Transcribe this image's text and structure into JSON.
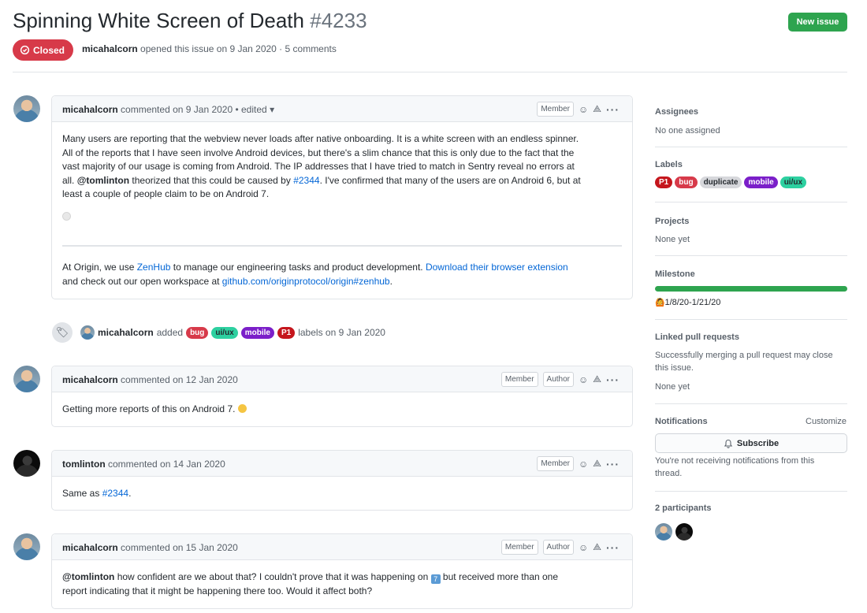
{
  "issue": {
    "title": "Spinning White Screen of Death",
    "number": "#4233",
    "new_issue_label": "New issue",
    "state": "Closed",
    "author": "micahalcorn",
    "meta": "opened this issue on 9 Jan 2020 · 5 comments"
  },
  "comments": [
    {
      "author": "micahalcorn",
      "meta": "commented on 9 Jan 2020 • edited",
      "badges": [
        "Member"
      ],
      "body_lines": [
        "Many users are reporting that the webview never loads after native onboarding. It is a white screen with an endless spinner.",
        "All of the reports that I have seen involve Android devices, but there's a slim chance that this is only due to the fact that the",
        "vast majority of our usage is coming from Android. The IP addresses that I have tried to match in Sentry reveal no errors at"
      ],
      "line4_pre": "all. ",
      "mention": "@tomlinton",
      "line4_mid": " theorized that this could be caused by ",
      "issue_ref": "#2344",
      "line4_post": ". I've confirmed that many of the users are on Android 6, but at",
      "line5": "least a couple of people claim to be on Android 7.",
      "footer_pre": "At Origin, we use ",
      "footer_link1": "ZenHub",
      "footer_mid": " to manage our engineering tasks and product development. ",
      "footer_link2": "Download their browser extension",
      "footer_line2_pre": "and check out our open workspace at ",
      "footer_link3": "github.com/originprotocol/origin#zenhub",
      "footer_end": "."
    },
    {
      "author": "micahalcorn",
      "meta": "commented on 12 Jan 2020",
      "badges": [
        "Member",
        "Author"
      ],
      "body": "Getting more reports of this on Android 7."
    },
    {
      "author": "tomlinton",
      "meta": "commented on 14 Jan 2020",
      "badges": [
        "Member"
      ],
      "body_pre": "Same as ",
      "issue_ref": "#2344",
      "body_post": "."
    },
    {
      "author": "micahalcorn",
      "meta": "commented on 15 Jan 2020",
      "badges": [
        "Member",
        "Author"
      ],
      "mention": "@tomlinton",
      "line1": " how confident are we about that? I couldn't prove that it was happening on ",
      "line1_post": " but received more than one",
      "line2": "report indicating that it might be happening there too. Would it affect both?"
    }
  ],
  "event": {
    "author": "micahalcorn",
    "action": "added",
    "labels": [
      "bug",
      "ui/ux",
      "mobile",
      "P1"
    ],
    "suffix": "labels on 9 Jan 2020"
  },
  "sidebar": {
    "assignees_title": "Assignees",
    "assignees_value": "No one assigned",
    "labels_title": "Labels",
    "labels": [
      "P1",
      "bug",
      "duplicate",
      "mobile",
      "ui/ux"
    ],
    "projects_title": "Projects",
    "projects_value": "None yet",
    "milestone_title": "Milestone",
    "milestone_progress": 1.0,
    "milestone_value": "1/8/20-1/21/20",
    "linked_title": "Linked pull requests",
    "linked_text_1": "Successfully merging a pull request may close",
    "linked_text_2": "this issue.",
    "linked_value": "None yet",
    "notifications_title": "Notifications",
    "customize_label": "Customize",
    "subscribe_label": "Subscribe",
    "notif_text_1": "You're not receiving notifications from this",
    "notif_text_2": "thread.",
    "participants_title": "2 participants"
  },
  "colors": {
    "closed": "#d73a49",
    "new_issue": "#2ea44f",
    "link": "#0366d6",
    "label_p1": "#c5161d",
    "label_bug": "#d73a4a",
    "label_duplicate": "#d6d7db",
    "label_mobile": "#7b1fc9",
    "label_uiux": "#2dd0a0"
  }
}
